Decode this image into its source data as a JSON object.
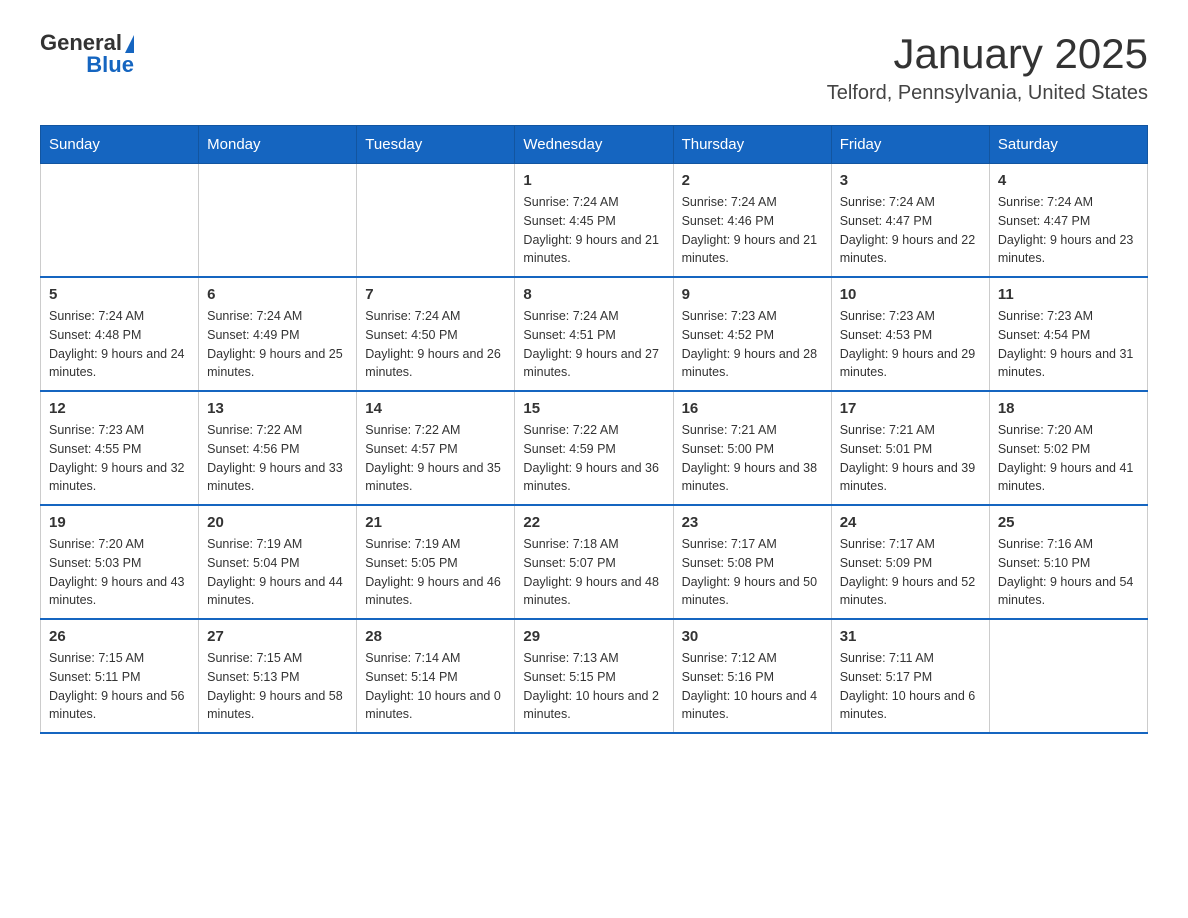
{
  "header": {
    "logo": {
      "general": "General",
      "blue": "Blue"
    },
    "title": "January 2025",
    "subtitle": "Telford, Pennsylvania, United States"
  },
  "days_of_week": [
    "Sunday",
    "Monday",
    "Tuesday",
    "Wednesday",
    "Thursday",
    "Friday",
    "Saturday"
  ],
  "weeks": [
    [
      null,
      null,
      null,
      {
        "day": "1",
        "sunrise": "Sunrise: 7:24 AM",
        "sunset": "Sunset: 4:45 PM",
        "daylight": "Daylight: 9 hours and 21 minutes."
      },
      {
        "day": "2",
        "sunrise": "Sunrise: 7:24 AM",
        "sunset": "Sunset: 4:46 PM",
        "daylight": "Daylight: 9 hours and 21 minutes."
      },
      {
        "day": "3",
        "sunrise": "Sunrise: 7:24 AM",
        "sunset": "Sunset: 4:47 PM",
        "daylight": "Daylight: 9 hours and 22 minutes."
      },
      {
        "day": "4",
        "sunrise": "Sunrise: 7:24 AM",
        "sunset": "Sunset: 4:47 PM",
        "daylight": "Daylight: 9 hours and 23 minutes."
      }
    ],
    [
      {
        "day": "5",
        "sunrise": "Sunrise: 7:24 AM",
        "sunset": "Sunset: 4:48 PM",
        "daylight": "Daylight: 9 hours and 24 minutes."
      },
      {
        "day": "6",
        "sunrise": "Sunrise: 7:24 AM",
        "sunset": "Sunset: 4:49 PM",
        "daylight": "Daylight: 9 hours and 25 minutes."
      },
      {
        "day": "7",
        "sunrise": "Sunrise: 7:24 AM",
        "sunset": "Sunset: 4:50 PM",
        "daylight": "Daylight: 9 hours and 26 minutes."
      },
      {
        "day": "8",
        "sunrise": "Sunrise: 7:24 AM",
        "sunset": "Sunset: 4:51 PM",
        "daylight": "Daylight: 9 hours and 27 minutes."
      },
      {
        "day": "9",
        "sunrise": "Sunrise: 7:23 AM",
        "sunset": "Sunset: 4:52 PM",
        "daylight": "Daylight: 9 hours and 28 minutes."
      },
      {
        "day": "10",
        "sunrise": "Sunrise: 7:23 AM",
        "sunset": "Sunset: 4:53 PM",
        "daylight": "Daylight: 9 hours and 29 minutes."
      },
      {
        "day": "11",
        "sunrise": "Sunrise: 7:23 AM",
        "sunset": "Sunset: 4:54 PM",
        "daylight": "Daylight: 9 hours and 31 minutes."
      }
    ],
    [
      {
        "day": "12",
        "sunrise": "Sunrise: 7:23 AM",
        "sunset": "Sunset: 4:55 PM",
        "daylight": "Daylight: 9 hours and 32 minutes."
      },
      {
        "day": "13",
        "sunrise": "Sunrise: 7:22 AM",
        "sunset": "Sunset: 4:56 PM",
        "daylight": "Daylight: 9 hours and 33 minutes."
      },
      {
        "day": "14",
        "sunrise": "Sunrise: 7:22 AM",
        "sunset": "Sunset: 4:57 PM",
        "daylight": "Daylight: 9 hours and 35 minutes."
      },
      {
        "day": "15",
        "sunrise": "Sunrise: 7:22 AM",
        "sunset": "Sunset: 4:59 PM",
        "daylight": "Daylight: 9 hours and 36 minutes."
      },
      {
        "day": "16",
        "sunrise": "Sunrise: 7:21 AM",
        "sunset": "Sunset: 5:00 PM",
        "daylight": "Daylight: 9 hours and 38 minutes."
      },
      {
        "day": "17",
        "sunrise": "Sunrise: 7:21 AM",
        "sunset": "Sunset: 5:01 PM",
        "daylight": "Daylight: 9 hours and 39 minutes."
      },
      {
        "day": "18",
        "sunrise": "Sunrise: 7:20 AM",
        "sunset": "Sunset: 5:02 PM",
        "daylight": "Daylight: 9 hours and 41 minutes."
      }
    ],
    [
      {
        "day": "19",
        "sunrise": "Sunrise: 7:20 AM",
        "sunset": "Sunset: 5:03 PM",
        "daylight": "Daylight: 9 hours and 43 minutes."
      },
      {
        "day": "20",
        "sunrise": "Sunrise: 7:19 AM",
        "sunset": "Sunset: 5:04 PM",
        "daylight": "Daylight: 9 hours and 44 minutes."
      },
      {
        "day": "21",
        "sunrise": "Sunrise: 7:19 AM",
        "sunset": "Sunset: 5:05 PM",
        "daylight": "Daylight: 9 hours and 46 minutes."
      },
      {
        "day": "22",
        "sunrise": "Sunrise: 7:18 AM",
        "sunset": "Sunset: 5:07 PM",
        "daylight": "Daylight: 9 hours and 48 minutes."
      },
      {
        "day": "23",
        "sunrise": "Sunrise: 7:17 AM",
        "sunset": "Sunset: 5:08 PM",
        "daylight": "Daylight: 9 hours and 50 minutes."
      },
      {
        "day": "24",
        "sunrise": "Sunrise: 7:17 AM",
        "sunset": "Sunset: 5:09 PM",
        "daylight": "Daylight: 9 hours and 52 minutes."
      },
      {
        "day": "25",
        "sunrise": "Sunrise: 7:16 AM",
        "sunset": "Sunset: 5:10 PM",
        "daylight": "Daylight: 9 hours and 54 minutes."
      }
    ],
    [
      {
        "day": "26",
        "sunrise": "Sunrise: 7:15 AM",
        "sunset": "Sunset: 5:11 PM",
        "daylight": "Daylight: 9 hours and 56 minutes."
      },
      {
        "day": "27",
        "sunrise": "Sunrise: 7:15 AM",
        "sunset": "Sunset: 5:13 PM",
        "daylight": "Daylight: 9 hours and 58 minutes."
      },
      {
        "day": "28",
        "sunrise": "Sunrise: 7:14 AM",
        "sunset": "Sunset: 5:14 PM",
        "daylight": "Daylight: 10 hours and 0 minutes."
      },
      {
        "day": "29",
        "sunrise": "Sunrise: 7:13 AM",
        "sunset": "Sunset: 5:15 PM",
        "daylight": "Daylight: 10 hours and 2 minutes."
      },
      {
        "day": "30",
        "sunrise": "Sunrise: 7:12 AM",
        "sunset": "Sunset: 5:16 PM",
        "daylight": "Daylight: 10 hours and 4 minutes."
      },
      {
        "day": "31",
        "sunrise": "Sunrise: 7:11 AM",
        "sunset": "Sunset: 5:17 PM",
        "daylight": "Daylight: 10 hours and 6 minutes."
      },
      null
    ]
  ]
}
